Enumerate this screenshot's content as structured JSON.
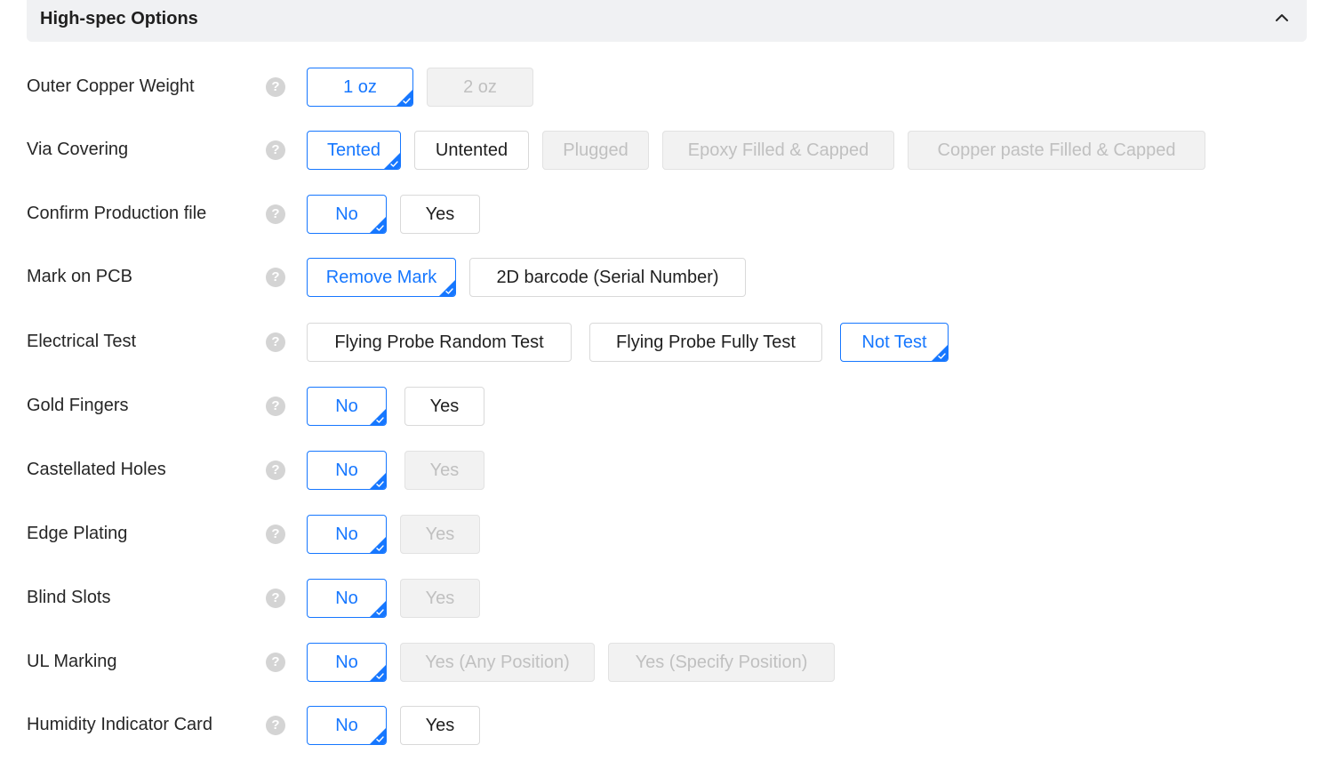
{
  "header": {
    "title": "High-spec Options",
    "collapse_icon": "chevron-up-icon"
  },
  "help_icon_glyph": "?",
  "accent_color": "#1677ff",
  "rows": [
    {
      "label": "Outer Copper Weight",
      "options": [
        {
          "label": "1 oz",
          "state": "selected"
        },
        {
          "label": "2 oz",
          "state": "disabled"
        }
      ]
    },
    {
      "label": "Via Covering",
      "options": [
        {
          "label": "Tented",
          "state": "selected"
        },
        {
          "label": "Untented",
          "state": "normal"
        },
        {
          "label": "Plugged",
          "state": "disabled"
        },
        {
          "label": "Epoxy Filled & Capped",
          "state": "disabled"
        },
        {
          "label": "Copper paste Filled & Capped",
          "state": "disabled"
        }
      ]
    },
    {
      "label": "Confirm Production file",
      "options": [
        {
          "label": "No",
          "state": "selected"
        },
        {
          "label": "Yes",
          "state": "normal"
        }
      ]
    },
    {
      "label": "Mark on PCB",
      "options": [
        {
          "label": "Remove Mark",
          "state": "selected"
        },
        {
          "label": "2D barcode (Serial Number)",
          "state": "normal"
        }
      ]
    },
    {
      "label": "Electrical Test",
      "options": [
        {
          "label": "Flying Probe Random Test",
          "state": "normal"
        },
        {
          "label": "Flying Probe Fully Test",
          "state": "normal"
        },
        {
          "label": "Not Test",
          "state": "selected"
        }
      ]
    },
    {
      "label": "Gold Fingers",
      "options": [
        {
          "label": "No",
          "state": "selected"
        },
        {
          "label": "Yes",
          "state": "normal"
        }
      ]
    },
    {
      "label": "Castellated Holes",
      "options": [
        {
          "label": "No",
          "state": "selected"
        },
        {
          "label": "Yes",
          "state": "disabled"
        }
      ]
    },
    {
      "label": "Edge Plating",
      "options": [
        {
          "label": "No",
          "state": "selected"
        },
        {
          "label": "Yes",
          "state": "disabled"
        }
      ]
    },
    {
      "label": "Blind Slots",
      "options": [
        {
          "label": "No",
          "state": "selected"
        },
        {
          "label": "Yes",
          "state": "disabled"
        }
      ]
    },
    {
      "label": "UL Marking",
      "options": [
        {
          "label": "No",
          "state": "selected"
        },
        {
          "label": "Yes (Any Position)",
          "state": "disabled"
        },
        {
          "label": "Yes (Specify Position)",
          "state": "disabled"
        }
      ]
    },
    {
      "label": "Humidity Indicator Card",
      "options": [
        {
          "label": "No",
          "state": "selected"
        },
        {
          "label": "Yes",
          "state": "normal"
        }
      ]
    }
  ]
}
